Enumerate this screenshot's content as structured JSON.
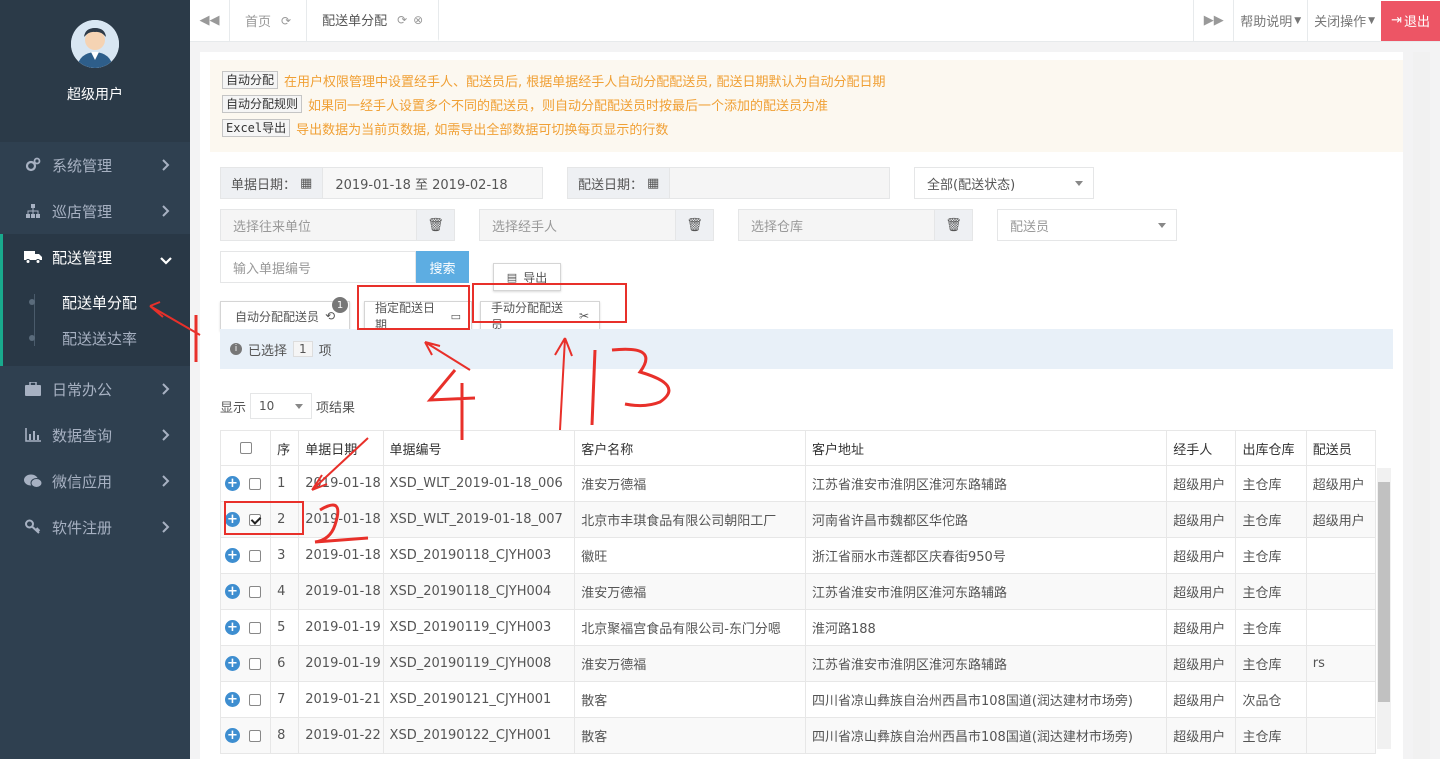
{
  "sidebar": {
    "user_name": "超级用户",
    "menu": [
      {
        "label": "系统管理",
        "icon": "gears-icon"
      },
      {
        "label": "巡店管理",
        "icon": "sitemap-icon"
      },
      {
        "label": "配送管理",
        "icon": "truck-icon"
      },
      {
        "label": "日常办公",
        "icon": "briefcase-icon"
      },
      {
        "label": "数据查询",
        "icon": "bar-chart-icon"
      },
      {
        "label": "微信应用",
        "icon": "wechat-icon"
      },
      {
        "label": "软件注册",
        "icon": "key-icon"
      }
    ],
    "submenu": [
      "配送单分配",
      "配送送达率"
    ]
  },
  "topbar": {
    "tabs": [
      "首页",
      "配送单分配"
    ],
    "help": "帮助说明",
    "close_ops": "关闭操作",
    "logout": "退出"
  },
  "notice": {
    "rows": [
      {
        "tag": "自动分配",
        "text": "在用户权限管理中设置经手人、配送员后, 根据单据经手人自动分配配送员, 配送日期默认为自动分配日期"
      },
      {
        "tag": "自动分配规则",
        "text": "如果同一经手人设置多个不同的配送员，则自动分配配送员时按最后一个添加的配送员为准"
      },
      {
        "tag": "Excel导出",
        "text": "导出数据为当前页数据, 如需导出全部数据可切换每页显示的行数"
      }
    ]
  },
  "filters": {
    "doc_date_label": "单据日期：",
    "doc_date_value": "2019-01-18 至 2019-02-18",
    "ship_date_label": "配送日期：",
    "ship_date_value": "",
    "status_select": "全部(配送状态)",
    "partner_placeholder": "选择往来单位",
    "handler_placeholder": "选择经手人",
    "warehouse_placeholder": "选择仓库",
    "courier_select": "配送员",
    "docno_placeholder": "输入单据编号",
    "search_btn": "搜索",
    "export_btn": "导出"
  },
  "actions": {
    "auto_assign": "自动分配配送员",
    "auto_badge": "1",
    "set_date": "指定配送日期",
    "manual_assign": "手动分配配送员"
  },
  "selection": {
    "prefix": "已选择",
    "count": "1",
    "suffix": "项"
  },
  "paging": {
    "show": "显示",
    "size": "10",
    "suffix": "项结果"
  },
  "table": {
    "headers": [
      "",
      "序",
      "单据日期",
      "单据编号",
      "客户名称",
      "客户地址",
      "经手人",
      "出库仓库",
      "配送员"
    ],
    "rows": [
      {
        "no": "1",
        "date": "2019-01-18",
        "code": "XSD_WLT_2019-01-18_006",
        "customer": "淮安万德福",
        "address": "江苏省淮安市淮阴区淮河东路辅路",
        "handler": "超级用户",
        "wh": "主仓库",
        "courier": "超级用户",
        "checked": false
      },
      {
        "no": "2",
        "date": "2019-01-18",
        "code": "XSD_WLT_2019-01-18_007",
        "customer": "北京市丰琪食品有限公司朝阳工厂",
        "address": "河南省许昌市魏都区华佗路",
        "handler": "超级用户",
        "wh": "主仓库",
        "courier": "超级用户",
        "checked": true
      },
      {
        "no": "3",
        "date": "2019-01-18",
        "code": "XSD_20190118_CJYH003",
        "customer": "徽旺",
        "address": "浙江省丽水市莲都区庆春街950号",
        "handler": "超级用户",
        "wh": "主仓库",
        "courier": "",
        "checked": false
      },
      {
        "no": "4",
        "date": "2019-01-18",
        "code": "XSD_20190118_CJYH004",
        "customer": "淮安万德福",
        "address": "江苏省淮安市淮阴区淮河东路辅路",
        "handler": "超级用户",
        "wh": "主仓库",
        "courier": "",
        "checked": false
      },
      {
        "no": "5",
        "date": "2019-01-19",
        "code": "XSD_20190119_CJYH003",
        "customer": "北京聚福宫食品有限公司-东门分嗯",
        "address": "淮河路188",
        "handler": "超级用户",
        "wh": "主仓库",
        "courier": "",
        "checked": false
      },
      {
        "no": "6",
        "date": "2019-01-19",
        "code": "XSD_20190119_CJYH008",
        "customer": "淮安万德福",
        "address": "江苏省淮安市淮阴区淮河东路辅路",
        "handler": "超级用户",
        "wh": "主仓库",
        "courier": "rs",
        "checked": false
      },
      {
        "no": "7",
        "date": "2019-01-21",
        "code": "XSD_20190121_CJYH001",
        "customer": "散客",
        "address": "四川省凉山彝族自治州西昌市108国道(润达建材市场旁)",
        "handler": "超级用户",
        "wh": "次品仓",
        "courier": "",
        "checked": false
      },
      {
        "no": "8",
        "date": "2019-01-22",
        "code": "XSD_20190122_CJYH001",
        "customer": "散客",
        "address": "四川省凉山彝族自治州西昌市108国道(润达建材市场旁)",
        "handler": "超级用户",
        "wh": "主仓库",
        "courier": "",
        "checked": false
      }
    ]
  },
  "colors": {
    "sidebar": "#2f4050",
    "accent": "#19aa8d",
    "logout": "#ed5565",
    "primary": "#5dade2",
    "annotation": "#e8302a"
  }
}
